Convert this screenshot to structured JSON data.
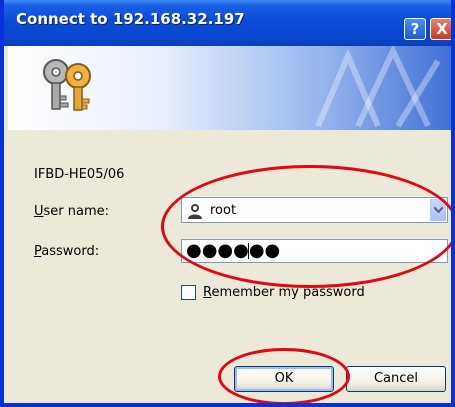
{
  "window": {
    "title": "Connect to 192.168.32.197",
    "help_button": "?",
    "close_button": "X"
  },
  "dialog": {
    "realm": "IFBD-HE05/06",
    "username_label": "User name:",
    "username_label_mnemonic": "U",
    "username_label_rest": "ser name:",
    "username_value": "root",
    "password_label_mnemonic": "P",
    "password_label_rest": "assword:",
    "password_masked": "●●●●●●",
    "remember_mnemonic": "R",
    "remember_rest": "emember my password",
    "remember_checked": false,
    "ok_label": "OK",
    "cancel_label": "Cancel"
  },
  "icons": [
    "keys-icon",
    "user-icon",
    "dropdown-arrow-icon"
  ],
  "colors": {
    "titlebar": "#0a46cf",
    "frame": "#0831d9",
    "dialog_bg": "#ece9d8",
    "annotation": "#e30613"
  }
}
